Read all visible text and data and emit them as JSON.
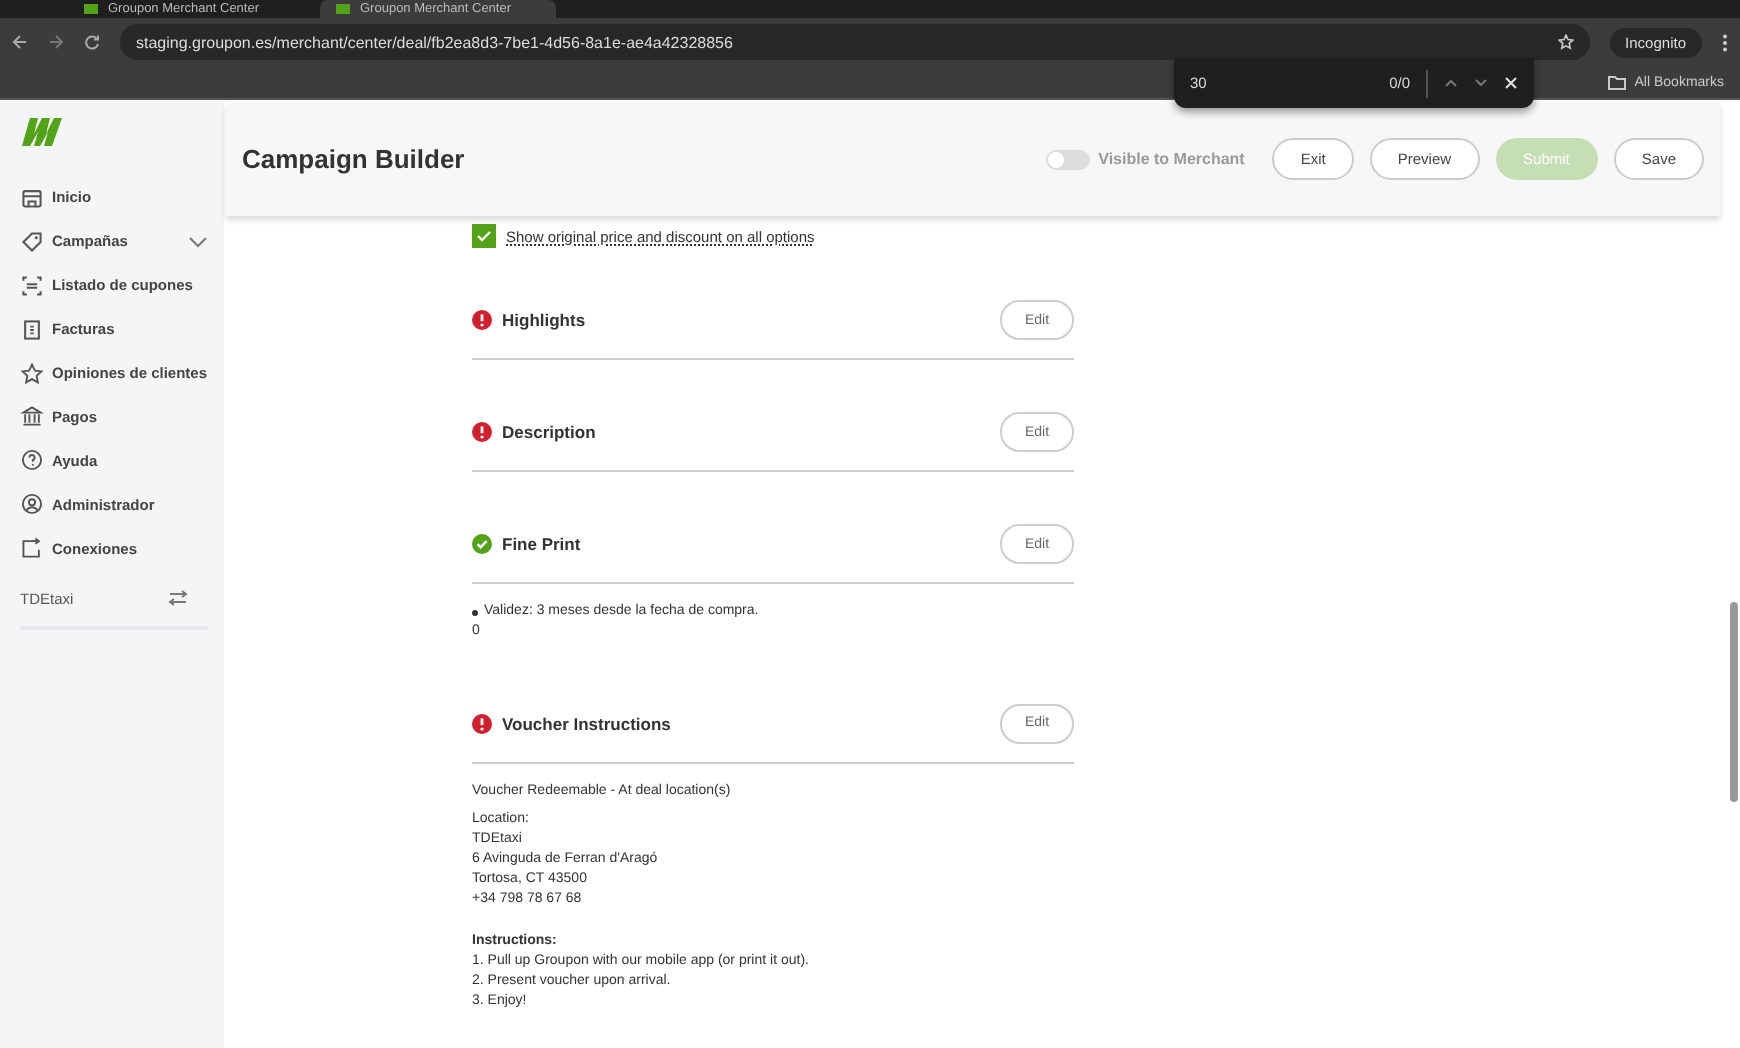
{
  "browser": {
    "tabs": [
      {
        "title": "Groupon Merchant Center",
        "selected": false
      },
      {
        "title": "Groupon Merchant Center",
        "selected": true
      }
    ],
    "url": "staging.groupon.es/merchant/center/deal/fb2ea8d3-7be1-4d56-8a1e-ae4a42328856",
    "profile": "Incognito",
    "bookmarks": "All Bookmarks",
    "find_bar": {
      "query": "30",
      "count": "0/0"
    }
  },
  "sidebar": {
    "items": [
      {
        "label": "Inicio",
        "expandable": false
      },
      {
        "label": "Campañas",
        "expandable": true
      },
      {
        "label": "Listado de cupones",
        "expandable": false
      },
      {
        "label": "Facturas",
        "expandable": false
      },
      {
        "label": "Opiniones de clientes",
        "expandable": false
      },
      {
        "label": "Pagos",
        "expandable": false
      },
      {
        "label": "Ayuda",
        "expandable": false
      },
      {
        "label": "Administrador",
        "expandable": false
      },
      {
        "label": "Conexiones",
        "expandable": false
      }
    ],
    "account": "TDEtaxi"
  },
  "header": {
    "title": "Campaign Builder",
    "toggle": {
      "label": "Visible to Merchant",
      "on": false
    },
    "buttons": [
      {
        "label": "Exit",
        "kind": "outline",
        "disabled": false
      },
      {
        "label": "Preview",
        "kind": "outline",
        "disabled": false
      },
      {
        "label": "Submit",
        "kind": "primary",
        "disabled": true
      },
      {
        "label": "Save",
        "kind": "outline",
        "disabled": false
      }
    ]
  },
  "option_checkbox": {
    "label": "Show original price and discount on all options",
    "checked": true
  },
  "sections": [
    {
      "title": "Highlights",
      "complete": false,
      "button": "Edit"
    },
    {
      "title": "Description",
      "complete": false,
      "button": "Edit"
    },
    {
      "title": "Fine Print",
      "complete": true,
      "button": "Edit",
      "body": [
        {
          "kind": "bullet",
          "text": "Validez: 3 meses desde la fecha de compra."
        },
        {
          "kind": "text",
          "text": "0"
        }
      ]
    },
    {
      "title": "Voucher Instructions",
      "complete": false,
      "button": "Edit",
      "body": [
        {
          "kind": "text",
          "text": "Voucher Redeemable - At deal location(s)"
        },
        {
          "kind": "lines",
          "lines": [
            "Location:",
            "TDEtaxi",
            "6 Avinguda de Ferran d'Aragó",
            "Tortosa, CT 43500",
            "+34 798 78 67 68"
          ]
        },
        {
          "kind": "titled",
          "title": "Instructions:",
          "lines": [
            "1. Pull up Groupon with our mobile app (or print it out).",
            "2. Present voucher upon arrival.",
            "3. Enjoy!"
          ]
        }
      ]
    }
  ]
}
